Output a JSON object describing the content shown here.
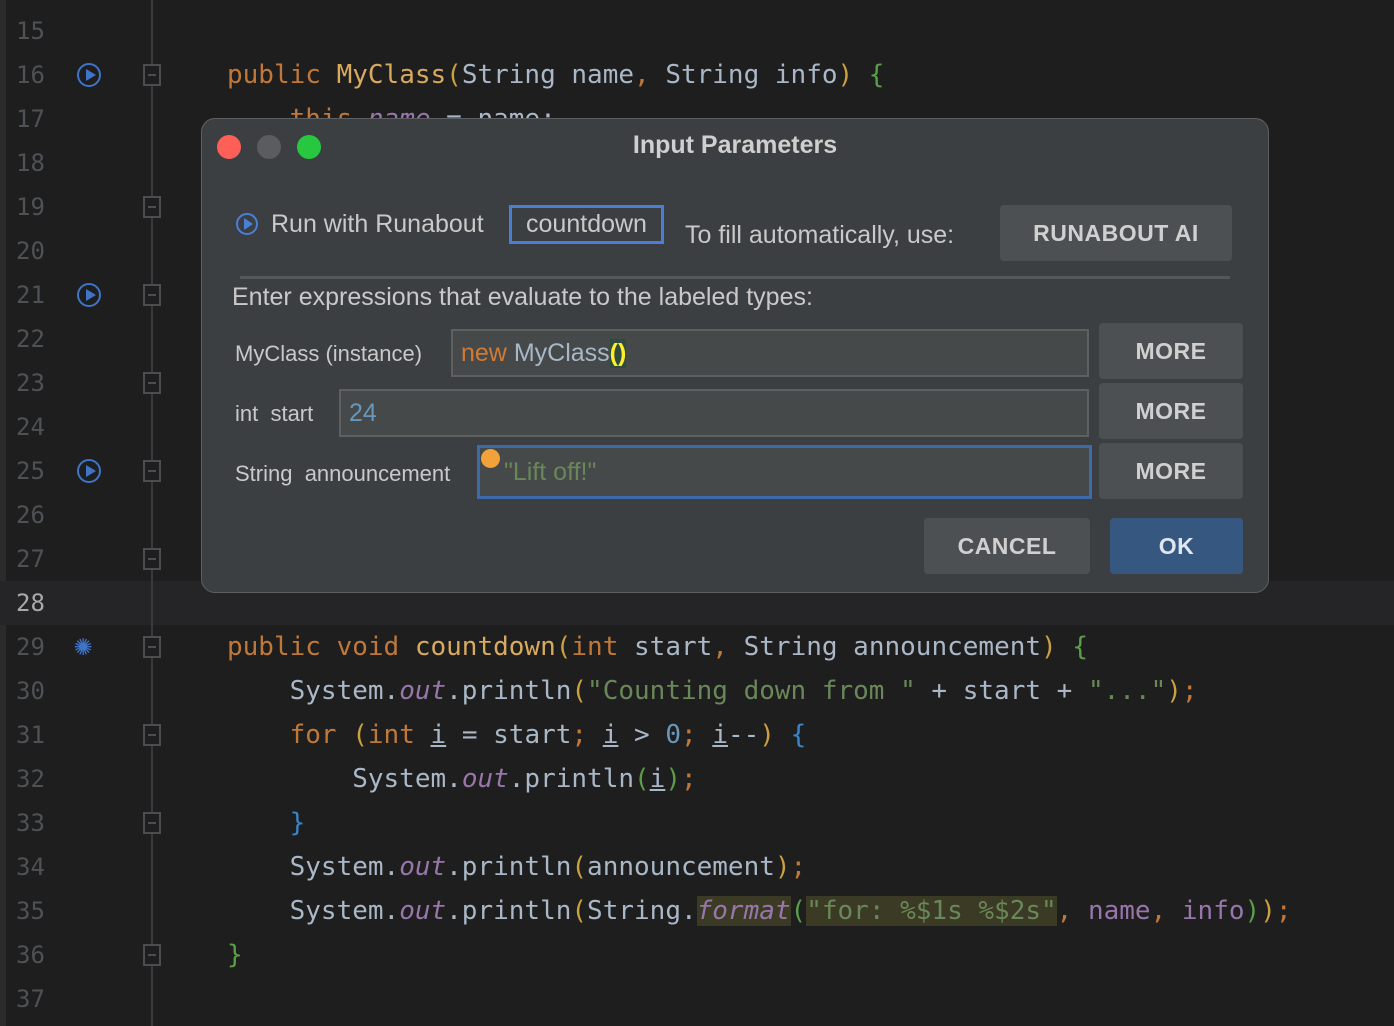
{
  "editor": {
    "current_line": 28,
    "lines": [
      {
        "num": 15,
        "tokens": []
      },
      {
        "num": 16,
        "tokens": [
          {
            "t": "public ",
            "c": "kw"
          },
          {
            "t": "MyClass",
            "c": "fn"
          },
          {
            "t": "(",
            "c": "p"
          },
          {
            "t": "String name",
            "c": ""
          },
          {
            "t": ", ",
            "c": "kw"
          },
          {
            "t": "String info",
            "c": ""
          },
          {
            "t": ")",
            "c": "p"
          },
          {
            "t": " {",
            "c": "g"
          }
        ]
      },
      {
        "num": 17,
        "tokens": [
          {
            "t": "    this",
            "c": "kw"
          },
          {
            "t": ".name",
            "c": "st"
          },
          {
            "t": " = name;",
            "c": ""
          }
        ]
      },
      {
        "num": 18,
        "tokens": []
      },
      {
        "num": 19,
        "tokens": []
      },
      {
        "num": 20,
        "tokens": []
      },
      {
        "num": 21,
        "tokens": []
      },
      {
        "num": 22,
        "tokens": []
      },
      {
        "num": 23,
        "tokens": []
      },
      {
        "num": 24,
        "tokens": []
      },
      {
        "num": 25,
        "tokens": []
      },
      {
        "num": 26,
        "tokens": []
      },
      {
        "num": 27,
        "tokens": []
      },
      {
        "num": 28,
        "tokens": []
      },
      {
        "num": 29,
        "tokens": [
          {
            "t": "public void ",
            "c": "kw"
          },
          {
            "t": "countdown",
            "c": "fn"
          },
          {
            "t": "(",
            "c": "p"
          },
          {
            "t": "int ",
            "c": "kw"
          },
          {
            "t": "start",
            "c": ""
          },
          {
            "t": ", ",
            "c": "kw"
          },
          {
            "t": "String announcement",
            "c": ""
          },
          {
            "t": ")",
            "c": "p"
          },
          {
            "t": " {",
            "c": "g"
          }
        ]
      },
      {
        "num": 30,
        "tokens": [
          {
            "t": "    System.",
            "c": ""
          },
          {
            "t": "out",
            "c": "st"
          },
          {
            "t": ".println",
            "c": ""
          },
          {
            "t": "(",
            "c": "p"
          },
          {
            "t": "\"Counting down from \"",
            "c": "str"
          },
          {
            "t": " + start + ",
            "c": ""
          },
          {
            "t": "\"...\"",
            "c": "str"
          },
          {
            "t": ")",
            "c": "p"
          },
          {
            "t": ";",
            "c": "kw"
          }
        ]
      },
      {
        "num": 31,
        "tokens": [
          {
            "t": "    for ",
            "c": "kw"
          },
          {
            "t": "(",
            "c": "p"
          },
          {
            "t": "int ",
            "c": "kw"
          },
          {
            "t": "i",
            "c": "ul"
          },
          {
            "t": " = start",
            "c": ""
          },
          {
            "t": "; ",
            "c": "kw"
          },
          {
            "t": "i",
            "c": "ul"
          },
          {
            "t": " > ",
            "c": ""
          },
          {
            "t": "0",
            "c": "num"
          },
          {
            "t": "; ",
            "c": "kw"
          },
          {
            "t": "i",
            "c": "ul"
          },
          {
            "t": "--",
            "c": ""
          },
          {
            "t": ")",
            "c": "p"
          },
          {
            "t": " {",
            "c": "b"
          }
        ]
      },
      {
        "num": 32,
        "tokens": [
          {
            "t": "        System.",
            "c": ""
          },
          {
            "t": "out",
            "c": "st"
          },
          {
            "t": ".println",
            "c": ""
          },
          {
            "t": "(",
            "c": "g"
          },
          {
            "t": "i",
            "c": "ul"
          },
          {
            "t": ")",
            "c": "g"
          },
          {
            "t": ";",
            "c": "kw"
          }
        ]
      },
      {
        "num": 33,
        "tokens": [
          {
            "t": "    }",
            "c": "b"
          }
        ]
      },
      {
        "num": 34,
        "tokens": [
          {
            "t": "    System.",
            "c": ""
          },
          {
            "t": "out",
            "c": "st"
          },
          {
            "t": ".println",
            "c": ""
          },
          {
            "t": "(",
            "c": "p"
          },
          {
            "t": "announcement",
            "c": ""
          },
          {
            "t": ")",
            "c": "p"
          },
          {
            "t": ";",
            "c": "kw"
          }
        ]
      },
      {
        "num": 35,
        "tokens": [
          {
            "t": "    System.",
            "c": ""
          },
          {
            "t": "out",
            "c": "st"
          },
          {
            "t": ".println",
            "c": ""
          },
          {
            "t": "(",
            "c": "p"
          },
          {
            "t": "String.",
            "c": ""
          },
          {
            "t": "format",
            "c": "st hl"
          },
          {
            "t": "(",
            "c": "g"
          },
          {
            "t": "\"for: %$1s %$2s\"",
            "c": "str hl"
          },
          {
            "t": ", ",
            "c": "kw"
          },
          {
            "t": "name",
            "c": "st2"
          },
          {
            "t": ", ",
            "c": "kw"
          },
          {
            "t": "info",
            "c": "st2"
          },
          {
            "t": ")",
            "c": "g"
          },
          {
            "t": ")",
            "c": "p"
          },
          {
            "t": ";",
            "c": "kw"
          }
        ]
      },
      {
        "num": 36,
        "tokens": [
          {
            "t": "}",
            "c": "g"
          }
        ]
      },
      {
        "num": 37,
        "tokens": []
      }
    ],
    "run_icon_lines": [
      16,
      21,
      25
    ],
    "loading_icon_line": 29
  },
  "dialog": {
    "title": "Input Parameters",
    "run_label": "Run with Runabout",
    "method": "countdown",
    "autofill_label": "To fill automatically, use:",
    "ai_button": "RUNABOUT AI",
    "instructions": "Enter expressions that evaluate to the labeled types:",
    "params": [
      {
        "label": "MyClass (instance)",
        "value_kw": "new",
        "value_rest": "MyClass",
        "value_paren": "()",
        "more": "MORE"
      },
      {
        "label": "int  start",
        "value": "24",
        "more": "MORE"
      },
      {
        "label": "String  announcement",
        "value": "\"Lift off!\"",
        "more": "MORE"
      }
    ],
    "cancel": "CANCEL",
    "ok": "OK",
    "colors": {
      "accent": "#4a7fd8",
      "ok": "#365880",
      "close": "#fe5f57",
      "min": "#5b5c5e",
      "max": "#27c840"
    }
  }
}
